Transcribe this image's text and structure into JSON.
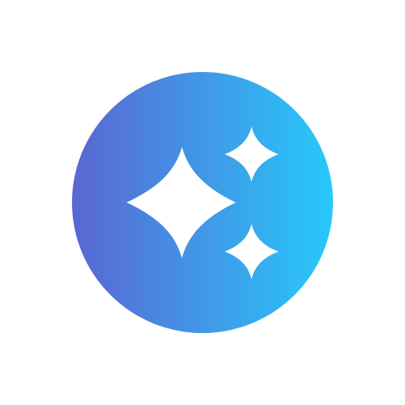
{
  "icon": {
    "name": "sparkles-icon",
    "colors": {
      "gradient_start": "#5A66D3",
      "gradient_end": "#27C9FA",
      "sparkle_fill": "#FFFFFF",
      "background": "#FFFFFF"
    }
  }
}
